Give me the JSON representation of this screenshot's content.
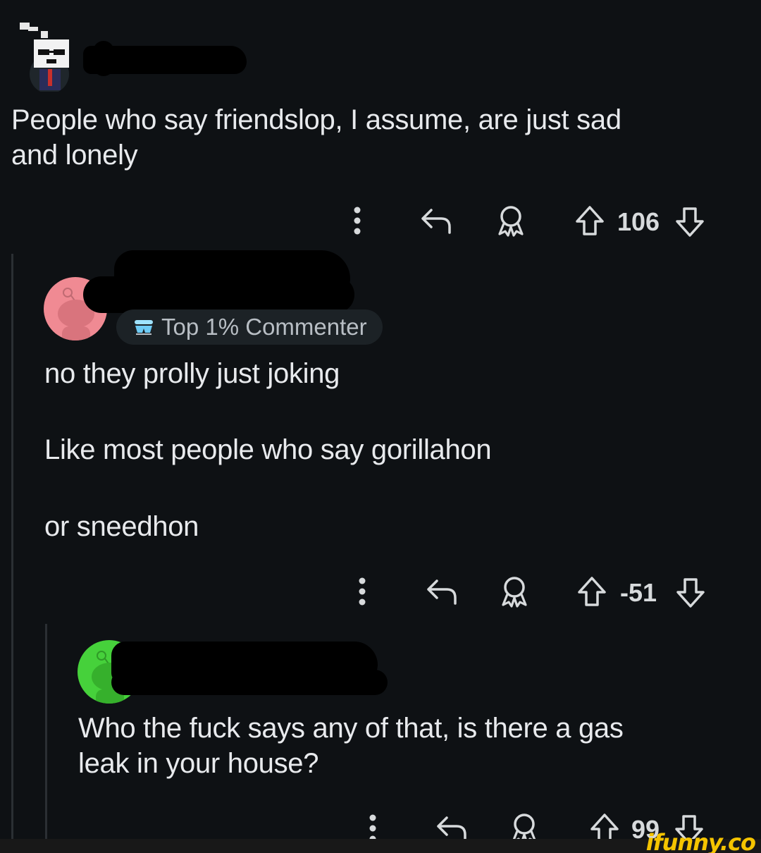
{
  "comments": [
    {
      "text_lines": [
        "People who say friendslop, I assume, are just sad",
        "and lonely"
      ],
      "score": "106"
    },
    {
      "badge": "Top 1% Commenter",
      "paragraphs": [
        "no they prolly just joking",
        "Like most people who say gorillahon",
        "or sneedhon"
      ],
      "score": "-51"
    },
    {
      "text_lines": [
        "Who the fuck says any of that, is there a gas",
        "leak in your house?"
      ],
      "score": "99"
    }
  ],
  "colors": {
    "background": "#0e1114",
    "badge_bg": "#1c2226",
    "avatar_pink": "#f08a93",
    "avatar_green": "#46d13b",
    "watermark": "#f5c400"
  },
  "icons": [
    "more-vertical-icon",
    "reply-icon",
    "award-icon",
    "upvote-icon",
    "downvote-icon"
  ],
  "watermark": "ifunny.co"
}
